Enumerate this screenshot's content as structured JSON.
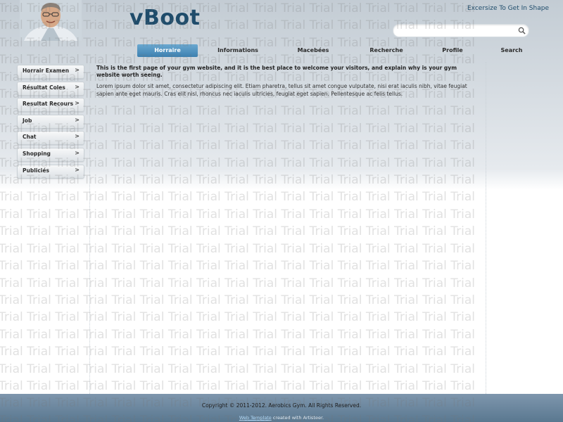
{
  "header": {
    "logo": "vBoot",
    "slogan": "Excersize To Get In Shape",
    "search_placeholder": ""
  },
  "nav": {
    "items": [
      "Horraire",
      "Informations",
      "Macebées",
      "Recherche",
      "Profile",
      "Search"
    ],
    "active_index": 0
  },
  "sidebar": {
    "items": [
      {
        "label": "Horrair Examen",
        "arrow": ">"
      },
      {
        "label": "Résultat Coles",
        "arrow": ">"
      },
      {
        "label": "Resultat Recours",
        "arrow": ">"
      },
      {
        "label": "Job",
        "arrow": ">"
      },
      {
        "label": "Chat",
        "arrow": ">"
      },
      {
        "label": "Shopping",
        "arrow": ">"
      },
      {
        "label": "Publiciés",
        "arrow": ">"
      }
    ]
  },
  "content": {
    "lead": "This is the first page of your gym website, and it is the best place to welcome your visitors, and explain why is your gym website worth seeing.",
    "body": "Lorem ipsum dolor sit amet, consectetur adipiscing elit. Etiam pharetra, tellus sit amet congue vulputate, nisi erat iaculis nibh, vitae feugiat sapien ante eget mauris. Cras elit nisl, rhoncus nec iaculis ultricies, feugiat eget sapien. Pellentesque ac felis tellus."
  },
  "footer": {
    "copyright": "Copyright © 2011-2012. Aerobics Gym. All Rights Reserved.",
    "credit_link": "Web Template",
    "credit_rest": " created with Artisteer."
  },
  "watermark": {
    "text": "Trial"
  },
  "colors": {
    "logo": "#1f4c6b",
    "nav_active": "#4a8cba",
    "footer": "#6b869e"
  }
}
